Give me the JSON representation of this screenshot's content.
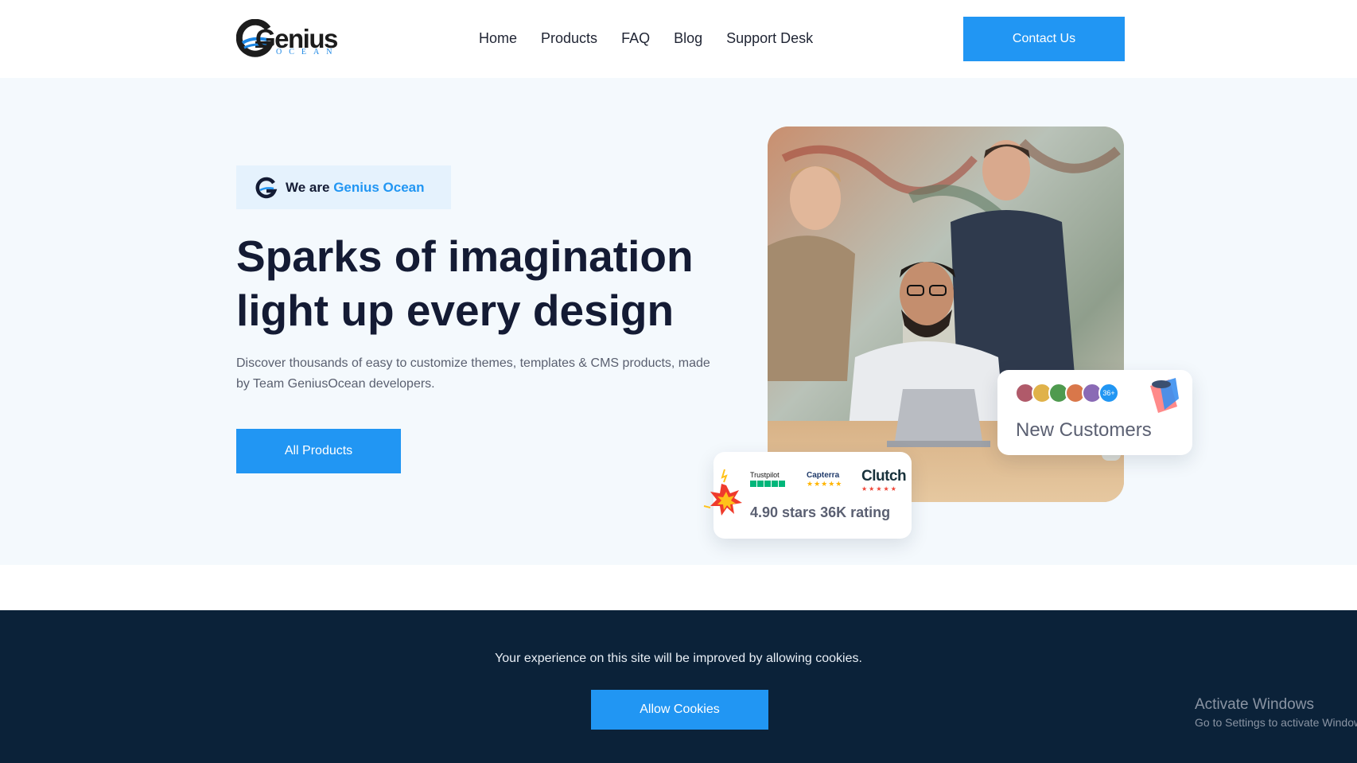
{
  "header": {
    "logo_word": "Genius",
    "logo_sub": "OCEAN",
    "nav": [
      "Home",
      "Products",
      "FAQ",
      "Blog",
      "Support Desk"
    ],
    "contact_label": "Contact Us"
  },
  "hero": {
    "badge_prefix": "We are",
    "badge_brand": "Genius Ocean",
    "headline_line1": "Sparks of imagination",
    "headline_line2": "light up every design",
    "description": "Discover thousands of easy to customize themes, templates & CMS products, made by Team GeniusOcean developers.",
    "cta_label": "All Products"
  },
  "rating_card": {
    "logos": [
      "Trustpilot",
      "Capterra",
      "Clutch"
    ],
    "text": "4.90 stars 36K rating"
  },
  "customers_card": {
    "count_badge": "36+",
    "text": "New Customers"
  },
  "cookie": {
    "message": "Your experience on this site will be improved by allowing cookies.",
    "button": "Allow Cookies"
  },
  "watermark": {
    "line1": "Activate Windows",
    "line2": "Go to Settings to activate Windows."
  },
  "colors": {
    "accent": "#2196f3",
    "hero_bg": "#f4f9fd",
    "cookie_bg": "#0b2239",
    "heading": "#141b34"
  }
}
